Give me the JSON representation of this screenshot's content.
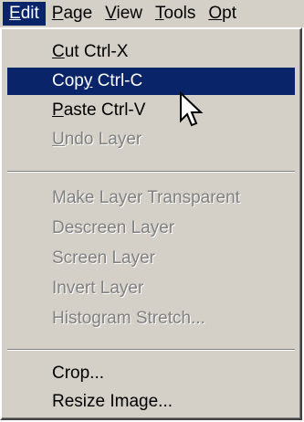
{
  "menubar": {
    "items": [
      {
        "accel": "E",
        "rest": "dit"
      },
      {
        "accel": "P",
        "rest": "age"
      },
      {
        "accel": "V",
        "rest": "iew"
      },
      {
        "accel": "T",
        "rest": "ools"
      },
      {
        "accel": "O",
        "rest": "pt"
      }
    ]
  },
  "dropdown": {
    "items": [
      {
        "pre": "",
        "accel": "C",
        "post": "ut Ctrl-X"
      },
      {
        "pre": "Cop",
        "accel": "y",
        "post": " Ctrl-C"
      },
      {
        "pre": "",
        "accel": "P",
        "post": "aste Ctrl-V"
      },
      {
        "pre": "",
        "accel": "U",
        "post": "ndo Layer"
      },
      {
        "label": "Make Layer Transparent"
      },
      {
        "label": "Descreen Layer"
      },
      {
        "label": "Screen Layer"
      },
      {
        "label": "Invert Layer"
      },
      {
        "label": "Histogram Stretch..."
      },
      {
        "label": "Crop..."
      },
      {
        "label": "Resize Image..."
      }
    ]
  },
  "colors": {
    "menu_bg": "#d4d0c8",
    "highlight": "#0a246a",
    "disabled_text": "#808080"
  },
  "cursor": {
    "icon": "arrow-cursor-icon"
  }
}
